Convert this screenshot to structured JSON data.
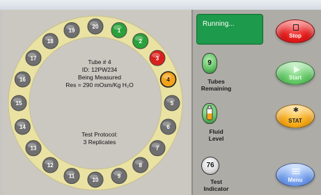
{
  "status": {
    "running_text": "Running..."
  },
  "carousel": {
    "tubes": [
      {
        "number": "1",
        "state": "done"
      },
      {
        "number": "2",
        "state": "done"
      },
      {
        "number": "3",
        "state": "error"
      },
      {
        "number": "4",
        "state": "measuring"
      },
      {
        "number": "5",
        "state": "pending"
      },
      {
        "number": "6",
        "state": "pending"
      },
      {
        "number": "7",
        "state": "pending"
      },
      {
        "number": "8",
        "state": "pending"
      },
      {
        "number": "9",
        "state": "pending"
      },
      {
        "number": "10",
        "state": "pending"
      },
      {
        "number": "11",
        "state": "pending"
      },
      {
        "number": "12",
        "state": "pending"
      },
      {
        "number": "13",
        "state": "pending"
      },
      {
        "number": "14",
        "state": "pending"
      },
      {
        "number": "15",
        "state": "pending"
      },
      {
        "number": "16",
        "state": "pending"
      },
      {
        "number": "17",
        "state": "pending"
      },
      {
        "number": "18",
        "state": "pending"
      },
      {
        "number": "19",
        "state": "pending"
      },
      {
        "number": "20",
        "state": "pending"
      }
    ],
    "tube_colors": {
      "done": "#2aa13a",
      "error": "#d8201c",
      "measuring": "#f3a21b",
      "pending": "#6f6f6f"
    },
    "info": {
      "tube": "Tube # 4",
      "id": "ID: 12PW234",
      "state": "Being Measured",
      "result": "Res = 290 mOsm/Kg H₂O"
    },
    "protocol": {
      "label": "Test Protocol:",
      "value": "3 Replicates"
    }
  },
  "indicators": {
    "tubes_remaining": {
      "value": "9",
      "label_line1": "Tubes",
      "label_line2": "Remaining",
      "icon": "tube-icon"
    },
    "fluid_level": {
      "label_line1": "Fluid",
      "label_line2": "Level",
      "icon": "fluid-bottle-icon"
    },
    "test_indicator": {
      "value": "76",
      "label_line1": "Test",
      "label_line2": "Indicator",
      "icon": "gauge-icon"
    }
  },
  "buttons": {
    "stop": {
      "label": "Stop",
      "icon": "stop-square-icon"
    },
    "start": {
      "label": "Start",
      "icon": "play-icon"
    },
    "stat": {
      "label": "STAT",
      "icon": "gear-icon"
    },
    "menu": {
      "label": "Menu",
      "icon": "menu-icon"
    }
  }
}
